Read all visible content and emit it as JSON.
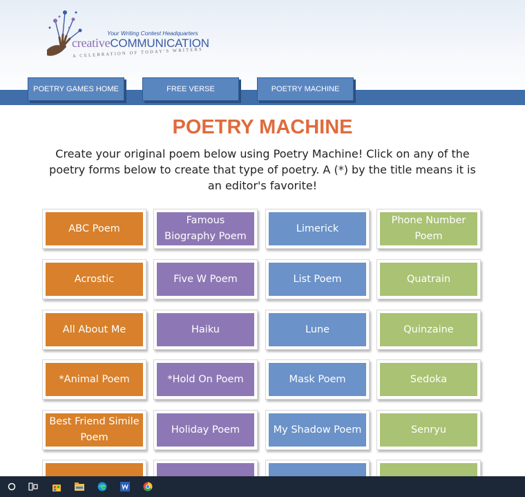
{
  "header": {
    "logo": {
      "tagline": "Your Writing Contest Headquarters",
      "name_part1": "creative",
      "name_part2": "COMMUNICATION",
      "subtitle": "A CELEBRATION OF TODAY'S WRITERS"
    },
    "nav": [
      {
        "label": "POETRY GAMES HOME"
      },
      {
        "label": "FREE VERSE"
      },
      {
        "label": "POETRY MACHINE"
      }
    ]
  },
  "main": {
    "title": "POETRY MACHINE",
    "intro": "Create your original poem below using Poetry Machine! Click on any of the poetry forms below to create that type of poetry. A (*) by the title means it is an editor's favorite!",
    "columns": [
      {
        "color": "#d8802b",
        "items": [
          "ABC Poem",
          "Acrostic",
          "All About Me",
          "*Animal Poem",
          "Best Friend Simile Poem",
          ""
        ]
      },
      {
        "color": "#8d78b5",
        "items": [
          "Famous Biography Poem",
          "Five W Poem",
          "Haiku",
          "*Hold On Poem",
          "Holiday Poem",
          ""
        ]
      },
      {
        "color": "#6b92c9",
        "items": [
          "Limerick",
          "List Poem",
          "Lune",
          "Mask Poem",
          "My Shadow Poem",
          ""
        ]
      },
      {
        "color": "#a9c273",
        "items": [
          "Phone Number Poem",
          "Quatrain",
          "Quinzaine",
          "Sedoka",
          "Senryu",
          ""
        ]
      }
    ]
  },
  "taskbar": {
    "icons": [
      "cortana-icon",
      "task-view-icon",
      "store-icon",
      "file-explorer-icon",
      "edge-icon",
      "word-icon",
      "chrome-icon"
    ]
  }
}
